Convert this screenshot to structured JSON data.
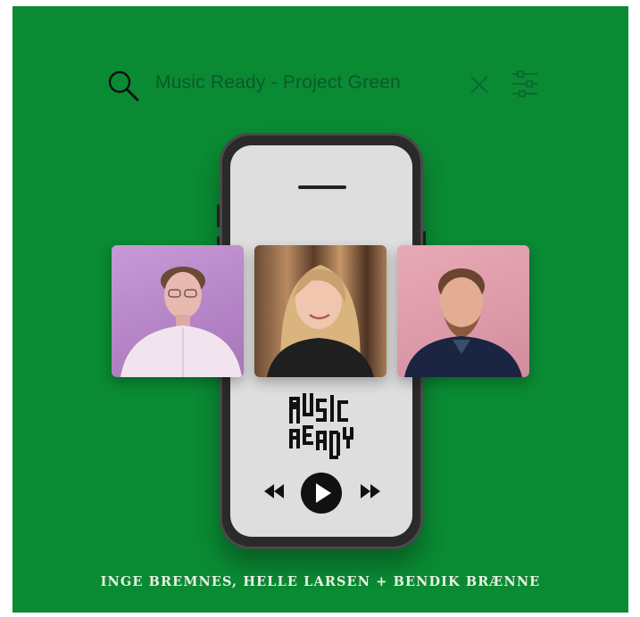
{
  "search": {
    "query": "Music Ready - Project Green"
  },
  "icons": {
    "search": "search-icon",
    "close": "close-icon",
    "filter": "filter-sliders-icon",
    "rewind": "rewind-icon",
    "play": "play-icon",
    "forward": "fast-forward-icon"
  },
  "player": {
    "logo_letters": "MUSIC READY"
  },
  "cards": [
    {
      "id": "left"
    },
    {
      "id": "middle"
    },
    {
      "id": "right"
    }
  ],
  "credits": {
    "artists": "INGE BREMNES, HELLE LARSEN + BENDIK BRÆNNE"
  },
  "colors": {
    "background": "#0a8a33",
    "search_text": "#0b5a2a",
    "screen": "#dedede",
    "phone": "#2a2a2a",
    "artist_text": "#e9f1e4"
  }
}
